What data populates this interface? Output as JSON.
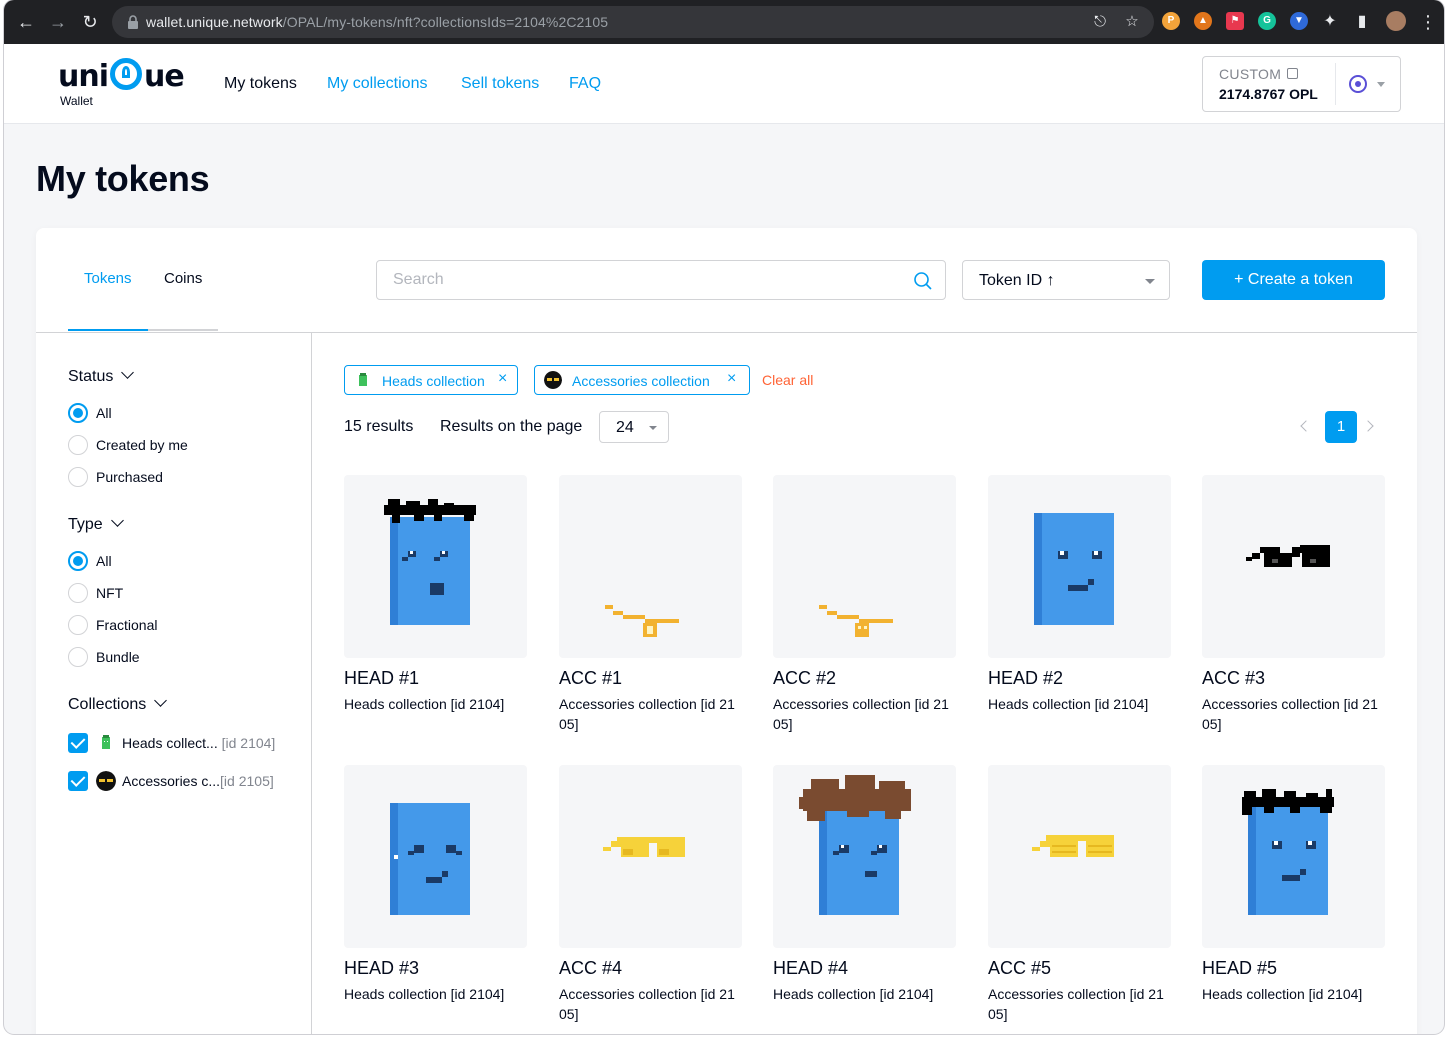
{
  "browser": {
    "url_host": "wallet.unique.network",
    "url_path": "/OPAL/my-tokens/nft?collectionsIds=2104%2C2105"
  },
  "header": {
    "logo_text": "uni",
    "logo_text2": "ue",
    "logo_sub": "Wallet",
    "nav": [
      {
        "label": "My tokens",
        "active": true
      },
      {
        "label": "My collections"
      },
      {
        "label": "Sell tokens"
      },
      {
        "label": "FAQ"
      }
    ],
    "account": {
      "label": "CUSTOM",
      "balance": "2174.8767 OPL"
    }
  },
  "page": {
    "title": "My tokens"
  },
  "tabs": [
    {
      "label": "Tokens",
      "active": true
    },
    {
      "label": "Coins"
    }
  ],
  "search": {
    "placeholder": "Search"
  },
  "sort": {
    "value": "Token ID ↑"
  },
  "create_button": "+  Create a token",
  "filters": {
    "status": {
      "title": "Status",
      "options": [
        "All",
        "Created by me",
        "Purchased"
      ],
      "selected": "All"
    },
    "type": {
      "title": "Type",
      "options": [
        "All",
        "NFT",
        "Fractional",
        "Bundle"
      ],
      "selected": "All"
    },
    "collections": {
      "title": "Collections",
      "items": [
        {
          "name": "Heads collect...",
          "id": "[id 2104]",
          "checked": true
        },
        {
          "name": "Accessories c...",
          "id": "[id 2105]",
          "checked": true
        }
      ]
    }
  },
  "chips": [
    {
      "label": "Heads collection"
    },
    {
      "label": "Accessories collection"
    }
  ],
  "clear_all": "Clear all",
  "results": {
    "count_label": "15 results",
    "per_page_label": "Results on the page",
    "per_page": "24",
    "current_page": "1"
  },
  "tokens": [
    {
      "name": "HEAD #1",
      "collection": "Heads collection [id 2104]",
      "art": "head-spiky-black"
    },
    {
      "name": "ACC #1",
      "collection": "Accessories collection [id 2105]",
      "art": "gold-chain-bitcoin"
    },
    {
      "name": "ACC #2",
      "collection": "Accessories collection [id 2105]",
      "art": "gold-chain-skull"
    },
    {
      "name": "HEAD #2",
      "collection": "Heads collection [id 2104]",
      "art": "head-bald"
    },
    {
      "name": "ACC #3",
      "collection": "Accessories collection [id 2105]",
      "art": "black-sunglasses"
    },
    {
      "name": "HEAD #3",
      "collection": "Heads collection [id 2104]",
      "art": "head-bald-2"
    },
    {
      "name": "ACC #4",
      "collection": "Accessories collection [id 2105]",
      "art": "yellow-sunglasses"
    },
    {
      "name": "HEAD #4",
      "collection": "Heads collection [id 2104]",
      "art": "head-curly-brown"
    },
    {
      "name": "ACC #5",
      "collection": "Accessories collection [id 2105]",
      "art": "yellow-shutter-shades"
    },
    {
      "name": "HEAD #5",
      "collection": "Heads collection [id 2104]",
      "art": "head-spiky-black-2"
    }
  ],
  "colors": {
    "accent": "#009cf0",
    "danger": "#ff6335",
    "text": "#040b1d",
    "muted": "#81858e"
  }
}
